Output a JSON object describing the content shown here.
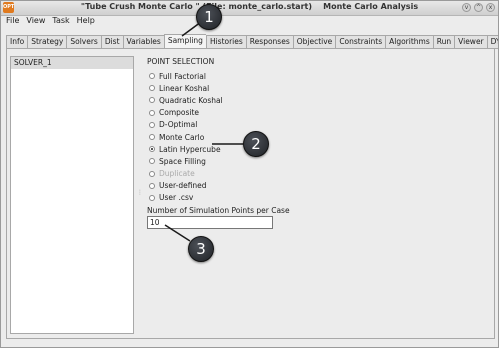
{
  "window": {
    "app_icon_text": "OPT",
    "title": "\"Tube Crush Monte Carlo \" (File: monte_carlo.start)    Monte Carlo Analysis",
    "controls": [
      "v",
      "^",
      "x"
    ]
  },
  "menu": [
    "File",
    "View",
    "Task",
    "Help"
  ],
  "tabs": [
    "Info",
    "Strategy",
    "Solvers",
    "Dist",
    "Variables",
    "Sampling",
    "Histories",
    "Responses",
    "Objective",
    "Constraints",
    "Algorithms",
    "Run",
    "Viewer",
    "DYNA Stats"
  ],
  "active_tab": "Sampling",
  "solvers": [
    "SOLVER_1"
  ],
  "sampling": {
    "section_label": "POINT SELECTION",
    "options": [
      "Full Factorial",
      "Linear Koshal",
      "Quadratic Koshal",
      "Composite",
      "D-Optimal",
      "Monte Carlo",
      "Latin Hypercube",
      "Space Filling",
      "Duplicate",
      "User-defined",
      "User .csv"
    ],
    "selected": "Latin Hypercube",
    "disabled": [
      "Duplicate"
    ],
    "points_label": "Number of Simulation Points per Case",
    "points_value": "10"
  },
  "callouts": [
    "1",
    "2",
    "3"
  ]
}
